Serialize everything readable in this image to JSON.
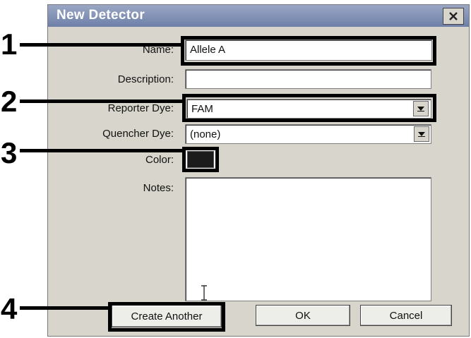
{
  "window": {
    "title": "New Detector"
  },
  "form": {
    "name_label": "Name:",
    "name_value": "Allele A",
    "description_label": "Description:",
    "description_value": "",
    "reporter_label": "Reporter Dye:",
    "reporter_value": "FAM",
    "quencher_label": "Quencher Dye:",
    "quencher_value": "(none)",
    "color_label": "Color:",
    "color_value": "#1b1b1b",
    "notes_label": "Notes:",
    "notes_value": ""
  },
  "buttons": {
    "create_another": "Create Another",
    "ok": "OK",
    "cancel": "Cancel"
  },
  "callouts": [
    "1",
    "2",
    "3",
    "4"
  ]
}
